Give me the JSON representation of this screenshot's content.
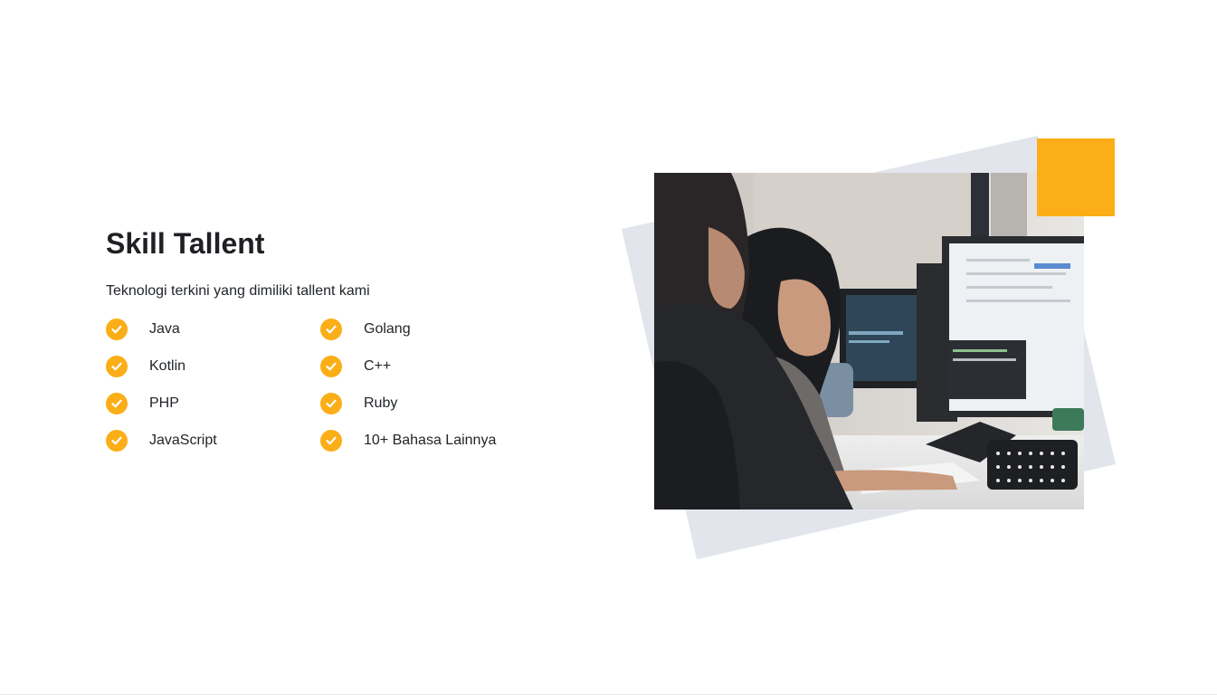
{
  "section": {
    "title": "Skill Tallent",
    "subtitle": "Teknologi terkini yang dimiliki tallent kami"
  },
  "skills": {
    "left": [
      "Java",
      "Kotlin",
      "PHP",
      "JavaScript"
    ],
    "right": [
      "Golang",
      "C++",
      "Ruby",
      "10+ Bahasa Lainnya"
    ]
  },
  "icons": {
    "check": "check-circle-icon"
  },
  "colors": {
    "accent": "#fbae17",
    "tilt_background": "#e2e5ec",
    "heading": "#1f2024",
    "text": "#212529"
  },
  "image": {
    "subject": "women-working-at-computers-photo"
  }
}
